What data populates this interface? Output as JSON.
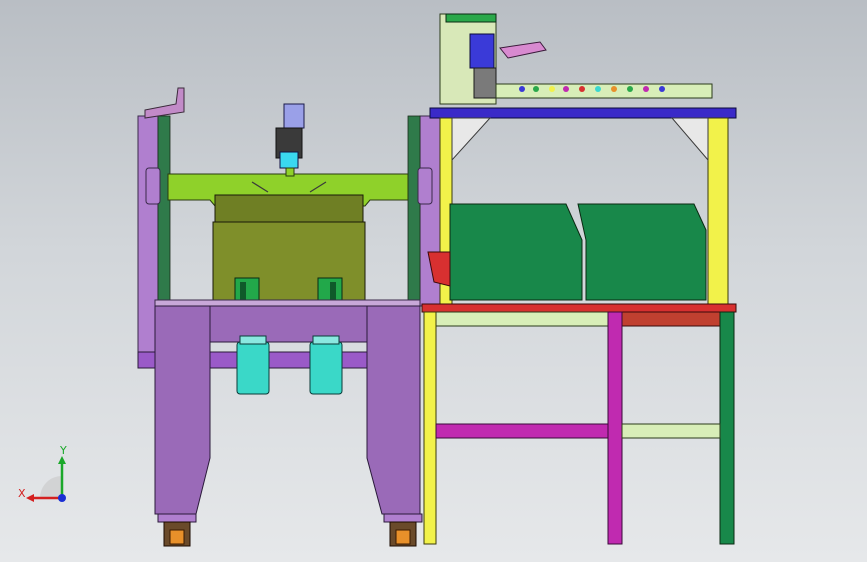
{
  "viewport": {
    "background_top": "#b9bec4",
    "background_bottom": "#e6e8ea"
  },
  "triad": {
    "x_label": "X",
    "y_label": "Y",
    "x_color": "#d42020",
    "y_color": "#1aa82a",
    "z_color": "#1a2fd4"
  },
  "colors": {
    "purple": "#9a6ab8",
    "purple_dark": "#7a4f98",
    "lime": "#8fd12a",
    "olive": "#7f8f2a",
    "green": "#18884a",
    "yellow": "#f2f24a",
    "magenta": "#c02ab0",
    "cyan": "#3ad8d0",
    "red": "#d83030",
    "blue": "#3a2ac8",
    "pale": "#d8eeb8"
  }
}
